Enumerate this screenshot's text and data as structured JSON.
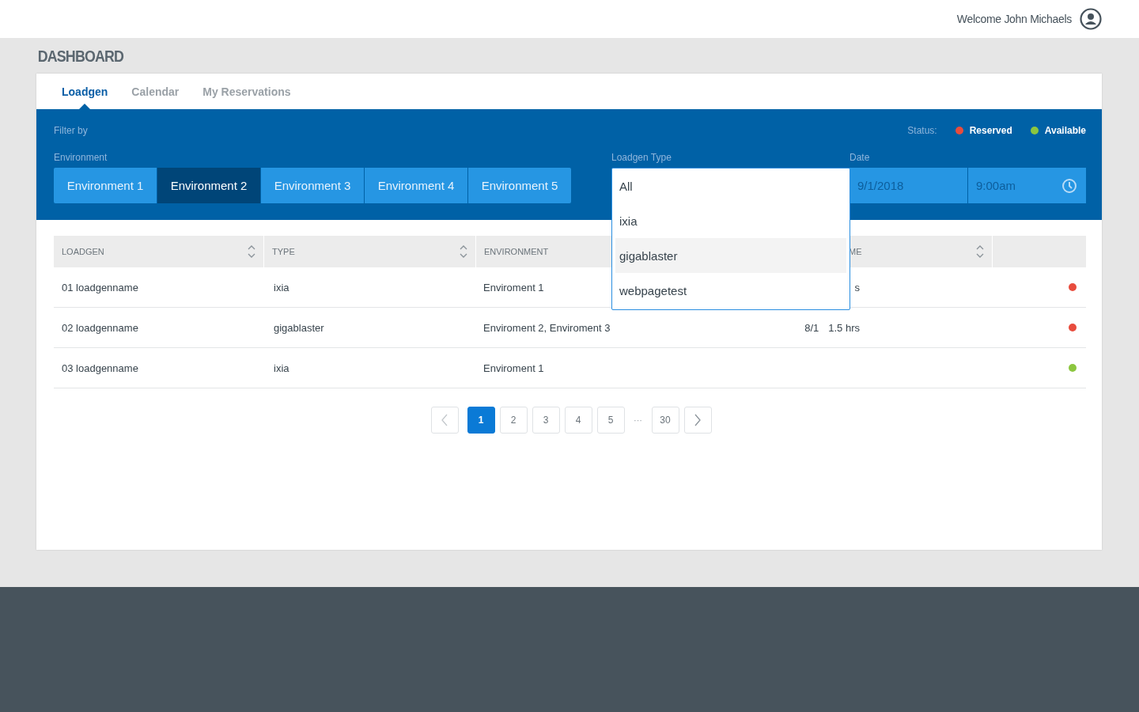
{
  "header": {
    "welcome": "Welcome John Michaels"
  },
  "page_title": "DASHBOARD",
  "tabs": [
    {
      "label": "Loadgen",
      "selected": true
    },
    {
      "label": "Calendar",
      "selected": false
    },
    {
      "label": "My Reservations",
      "selected": false
    }
  ],
  "filter": {
    "title": "Filter by",
    "status_label": "Status:",
    "legend": [
      {
        "label": "Reserved",
        "color": "#e84c3d"
      },
      {
        "label": "Available",
        "color": "#8cc63f"
      }
    ],
    "environment": {
      "label": "Environment",
      "options": [
        {
          "label": "Environment 1",
          "selected": false
        },
        {
          "label": "Environment 2",
          "selected": true
        },
        {
          "label": "Environment 3",
          "selected": false
        },
        {
          "label": "Environment 4",
          "selected": false
        },
        {
          "label": "Environment 5",
          "selected": false
        }
      ]
    },
    "loadgen_type": {
      "label": "Loadgen Type",
      "expanded": true,
      "options": [
        {
          "label": "All",
          "selected": false
        },
        {
          "label": "ixia",
          "selected": false
        },
        {
          "label": "gigablaster",
          "selected": true
        },
        {
          "label": "webpagetest",
          "selected": false
        }
      ]
    },
    "date": {
      "label": "Date",
      "date": "9/1/2018",
      "time": "9:00am"
    }
  },
  "table": {
    "columns": [
      {
        "label": "LOADGEN",
        "sortable": true
      },
      {
        "label": "TYPE",
        "sortable": true
      },
      {
        "label": "ENVIRONMENT"
      },
      {
        "label": "ME",
        "sortable": true
      }
    ],
    "rows": [
      {
        "cells": [
          "01 loadgenname",
          "ixia",
          "Enviroment 1"
        ],
        "column_4": [
          "s"
        ],
        "color": "#e84c3d"
      },
      {
        "cells": [
          "02 loadgenname",
          "gigablaster",
          "Enviroment 2, Enviroment 3"
        ],
        "column_4": [
          "8/1",
          "1.5 hrs"
        ],
        "color": "#e84c3d"
      },
      {
        "cells": [
          "03 loadgenname",
          "ixia",
          "Enviroment 1"
        ],
        "color": "#8cc63f"
      }
    ]
  },
  "pagination": [
    {
      "kind": "page",
      "label": "1",
      "selected": true
    },
    {
      "kind": "page",
      "label": "2",
      "selected": false
    },
    {
      "kind": "page",
      "label": "3",
      "selected": false
    },
    {
      "kind": "page",
      "label": "4",
      "selected": false
    },
    {
      "kind": "page",
      "label": "5",
      "selected": false
    },
    {
      "kind": "ellipsis",
      "label": "···"
    },
    {
      "kind": "page",
      "label": "30",
      "selected": false
    }
  ]
}
